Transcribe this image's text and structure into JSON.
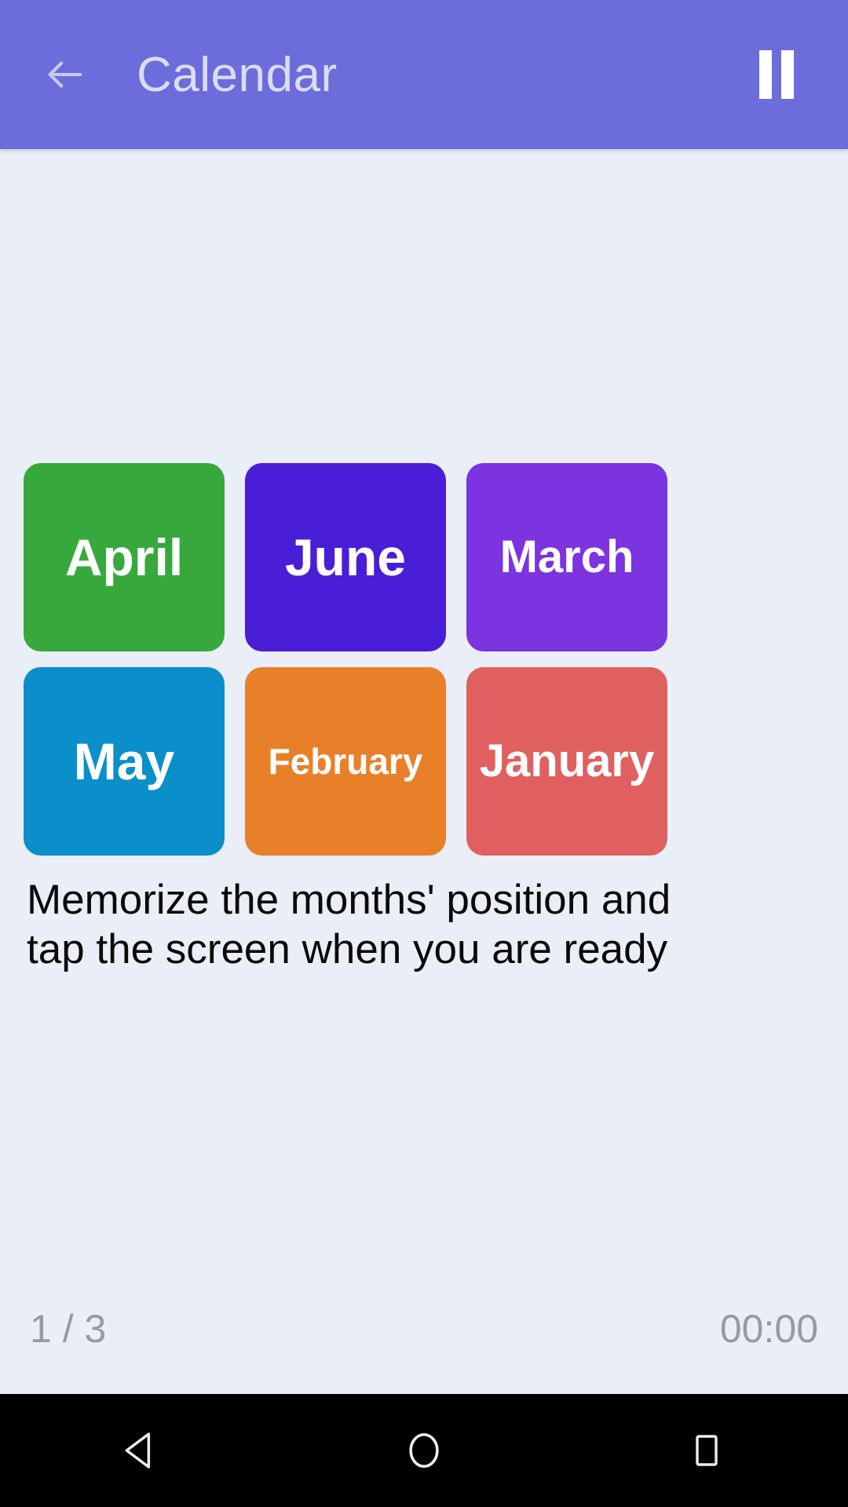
{
  "appbar": {
    "title": "Calendar",
    "back_icon": "back-arrow-icon",
    "pause_icon": "pause-icon",
    "background_color": "#6C6DDB",
    "title_color": "#DCDCF2"
  },
  "screen": {
    "background_color": "#EAEEF7"
  },
  "grid": {
    "columns": 3,
    "rows": 2,
    "tiles": [
      {
        "label": "April",
        "color": "#37A93C",
        "size": "lg",
        "position": "r1c1"
      },
      {
        "label": "June",
        "color": "#4A1ED6",
        "size": "lg",
        "position": "r1c2"
      },
      {
        "label": "March",
        "color": "#7B34E0",
        "size": "md",
        "position": "r1c3"
      },
      {
        "label": "May",
        "color": "#0B8FCB",
        "size": "lg",
        "position": "r2c1"
      },
      {
        "label": "February",
        "color": "#E8802A",
        "size": "sm",
        "position": "r2c2"
      },
      {
        "label": "January",
        "color": "#E06060",
        "size": "md",
        "position": "r2c3"
      }
    ]
  },
  "instruction": {
    "text": "Memorize the months' position and tap the screen when you are ready"
  },
  "status": {
    "progress": "1 / 3",
    "timer": "00:00",
    "color": "#9A9A9E"
  },
  "navbar": {
    "back_icon": "nav-back-triangle-icon",
    "home_icon": "nav-home-circle-icon",
    "recents_icon": "nav-recents-square-icon",
    "background_color": "#000000"
  }
}
